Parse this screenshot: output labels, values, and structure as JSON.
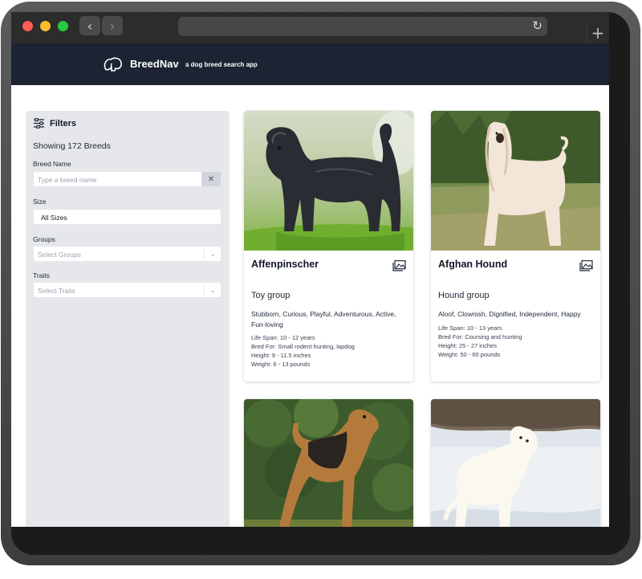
{
  "app": {
    "name": "BreedNav",
    "tagline": "a dog breed search app"
  },
  "browser": {
    "back_glyph": "‹",
    "forward_glyph": "›",
    "reload_glyph": "↻",
    "newtab_glyph": "+"
  },
  "sidebar": {
    "title": "Filters",
    "count_text": "Showing 172 Breeds",
    "breed_name": {
      "label": "Breed Name",
      "placeholder": "Type a breed name",
      "clear_glyph": "✕"
    },
    "size": {
      "label": "Size",
      "value": "All Sizes"
    },
    "groups": {
      "label": "Groups",
      "placeholder": "Select Groups"
    },
    "traits": {
      "label": "Traits",
      "placeholder": "Select Traits"
    },
    "caret_glyph": "⌄"
  },
  "breeds": [
    {
      "name": "Affenpinscher",
      "group": "Toy group",
      "temperament": "Stubborn, Curious, Playful, Adventurous, Active, Fun-loving",
      "life_span": "Life Span: 10 - 12 years",
      "bred_for": "Bred For: Small rodent hunting, lapdog",
      "height": "Height: 9 - 11.5 inches",
      "weight": "Weight: 6 - 13 pounds"
    },
    {
      "name": "Afghan Hound",
      "group": "Hound group",
      "temperament": "Aloof, Clownish, Dignified, Independent, Happy",
      "life_span": "Life Span: 10 - 13 years",
      "bred_for": "Bred For: Coursing and hunting",
      "height": "Height: 25 - 27 inches",
      "weight": "Weight: 50 - 60 pounds"
    }
  ],
  "colors": {
    "header_bg": "#1c2333",
    "sidebar_bg": "#e5e7eb",
    "accent_text": "#111827"
  }
}
